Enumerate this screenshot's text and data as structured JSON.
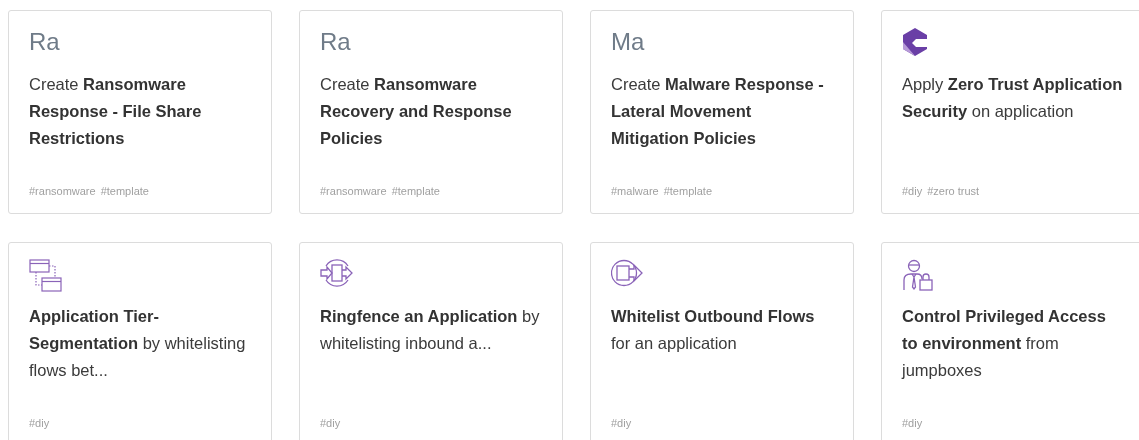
{
  "cards": [
    {
      "icon": {
        "kind": "initials",
        "text": "Ra"
      },
      "description": "Create **Ransomware Response - File Share Restrictions**",
      "tags": [
        "#ransomware",
        "#template"
      ]
    },
    {
      "icon": {
        "kind": "initials",
        "text": "Ra"
      },
      "description": "Create **Ransomware Recovery and Response Policies**",
      "tags": [
        "#ransomware",
        "#template"
      ]
    },
    {
      "icon": {
        "kind": "initials",
        "text": "Ma"
      },
      "description": "Create **Malware Response - Lateral Movement Mitigation Policies**",
      "tags": [
        "#malware",
        "#template"
      ]
    },
    {
      "icon": {
        "kind": "logo"
      },
      "description": "Apply **Zero Trust Application Security** on application",
      "tags": [
        "#diy",
        "#zero trust"
      ]
    },
    {
      "icon": {
        "kind": "tiers"
      },
      "description": "**Application Tier-Segmentation** by whitelisting flows bet...",
      "tags": [
        "#diy"
      ]
    },
    {
      "icon": {
        "kind": "ringfence"
      },
      "description": "**Ringfence an Application** by whitelisting inbound a...",
      "tags": [
        "#diy"
      ]
    },
    {
      "icon": {
        "kind": "outbound"
      },
      "description": "**Whitelist Outbound Flows** for an application",
      "tags": [
        "#diy"
      ]
    },
    {
      "icon": {
        "kind": "user-lock"
      },
      "description": "**Control Privileged Access to environment** from jumpboxes",
      "tags": [
        "#diy"
      ]
    }
  ]
}
